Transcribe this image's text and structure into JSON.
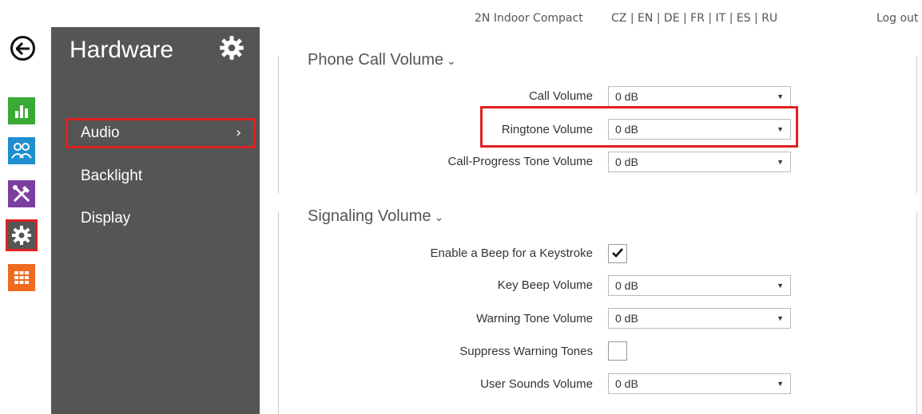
{
  "header": {
    "device_name": "2N Indoor Compact",
    "languages": "CZ | EN | DE | FR | IT | ES | RU",
    "logout": "Log out"
  },
  "rail": {
    "icons": [
      "back-arrow-icon",
      "chart-icon",
      "users-icon",
      "tools-icon",
      "gear-icon",
      "grid-icon"
    ],
    "colors": {
      "green": "#3aa935",
      "blue": "#1f8fd0",
      "purple": "#7b3fa0",
      "gray": "#555555",
      "orange": "#ef6a1f",
      "highlight": "#e02020"
    }
  },
  "menu": {
    "title": "Hardware",
    "items": [
      {
        "label": "Audio",
        "chevron": "›"
      },
      {
        "label": "Backlight"
      },
      {
        "label": "Display"
      }
    ]
  },
  "phone_call": {
    "title": "Phone Call Volume",
    "caret": "⌄",
    "rows": [
      {
        "label": "Call Volume",
        "value": "0 dB"
      },
      {
        "label": "Ringtone Volume",
        "value": "0 dB"
      },
      {
        "label": "Call-Progress Tone Volume",
        "value": "0 dB"
      }
    ]
  },
  "signaling": {
    "title": "Signaling Volume",
    "caret": "⌄",
    "beep_label": "Enable a Beep for a Keystroke",
    "beep_checked": true,
    "key_beep_label": "Key Beep Volume",
    "key_beep_value": "0 dB",
    "warning_tone_label": "Warning Tone Volume",
    "warning_tone_value": "0 dB",
    "suppress_label": "Suppress Warning Tones",
    "suppress_checked": false,
    "user_sounds_label": "User Sounds Volume",
    "user_sounds_value": "0 dB"
  },
  "select_arrow": "▼"
}
